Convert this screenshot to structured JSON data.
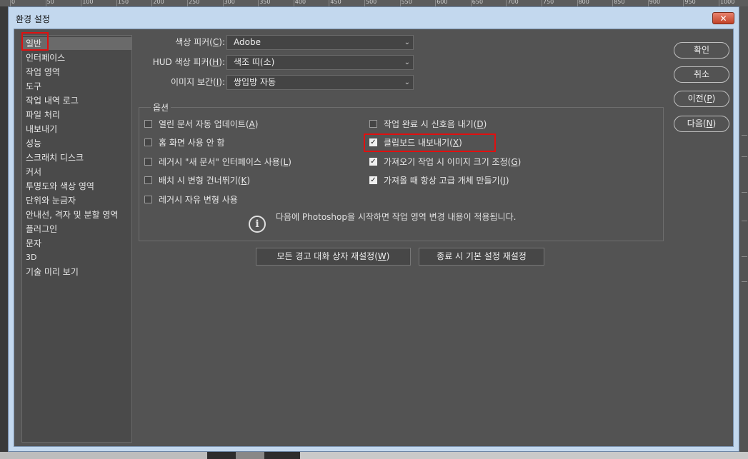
{
  "ruler": {
    "ticks": [
      "0",
      "50",
      "100",
      "150",
      "200",
      "250",
      "300",
      "350",
      "400",
      "450",
      "500",
      "550",
      "600",
      "650",
      "700",
      "750",
      "800",
      "850",
      "900",
      "950",
      "1000"
    ]
  },
  "window": {
    "title": "환경 설정",
    "close_label": "✕"
  },
  "sidebar": {
    "items": [
      {
        "label": "일반"
      },
      {
        "label": "인터페이스"
      },
      {
        "label": "작업 영역"
      },
      {
        "label": "도구"
      },
      {
        "label": "작업 내역 로그"
      },
      {
        "label": "파일 처리"
      },
      {
        "label": "내보내기"
      },
      {
        "label": "성능"
      },
      {
        "label": "스크래치 디스크"
      },
      {
        "label": "커서"
      },
      {
        "label": "투명도와 색상 영역"
      },
      {
        "label": "단위와 눈금자"
      },
      {
        "label": "안내선, 격자 및 분할 영역"
      },
      {
        "label": "플러그인"
      },
      {
        "label": "문자"
      },
      {
        "label": "3D"
      },
      {
        "label": "기술 미리 보기"
      }
    ]
  },
  "form": {
    "color_picker": {
      "label": "색상 피커(",
      "key": "C",
      "tail": "):",
      "value": "Adobe"
    },
    "hud_picker": {
      "label": "HUD 색상 피커(",
      "key": "H",
      "tail": "):",
      "value": "색조 띠(소)"
    },
    "interpolation": {
      "label": "이미지 보간(",
      "key": "I",
      "tail": "):",
      "value": "쌍입방 자동"
    }
  },
  "options": {
    "legend": "옵션",
    "left": [
      {
        "text": "열린 문서 자동 업데이트(",
        "key": "A",
        "tail": ")",
        "checked": false
      },
      {
        "text": "홈 화면 사용 안 함",
        "key": "",
        "tail": "",
        "checked": false
      },
      {
        "text": "레거시 \"새 문서\" 인터페이스 사용(",
        "key": "L",
        "tail": ")",
        "checked": false
      },
      {
        "text": "배치 시 변형 건너뛰기(",
        "key": "K",
        "tail": ")",
        "checked": false
      },
      {
        "text": "레거시 자유 변형 사용",
        "key": "",
        "tail": "",
        "checked": false
      }
    ],
    "right": [
      {
        "text": "작업 완료 시 신호음 내기(",
        "key": "D",
        "tail": ")",
        "checked": false
      },
      {
        "text": "클립보드 내보내기(",
        "key": "X",
        "tail": ")",
        "checked": true
      },
      {
        "text": "가져오기 작업 시 이미지 크기 조정(",
        "key": "G",
        "tail": ")",
        "checked": true
      },
      {
        "text": "가져올 때 항상 고급 개체 만들기(",
        "key": "J",
        "tail": ")",
        "checked": true
      }
    ],
    "info_text": "다음에 Photoshop을 시작하면 작업 영역 변경 내용이 적용됩니다."
  },
  "reset_buttons": {
    "reset_warnings": {
      "text": "모든 경고 대화 상자 재설정(",
      "key": "W",
      "tail": ")"
    },
    "reset_on_quit": {
      "text": "종료 시 기본 설정 재설정",
      "key": "",
      "tail": ""
    }
  },
  "actions": {
    "ok": {
      "text": "확인",
      "key": "",
      "tail": ""
    },
    "cancel": {
      "text": "취소",
      "key": "",
      "tail": ""
    },
    "prev": {
      "text": "이전(",
      "key": "P",
      "tail": ")"
    },
    "next": {
      "text": "다음(",
      "key": "N",
      "tail": ")"
    }
  },
  "colors": {
    "panel": "#535353",
    "frame": "#c3d8ee",
    "highlight": "#e01010"
  }
}
